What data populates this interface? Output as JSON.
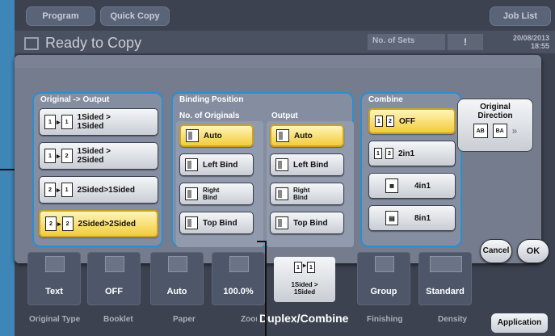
{
  "header": {
    "program_label": "Program",
    "quick_copy_label": "Quick Copy",
    "job_list_label": "Job List",
    "status": "Ready to Copy",
    "no_of_sets_label": "No. of Sets",
    "warning_icon": "!",
    "date": "20/08/2013",
    "time": "18:55"
  },
  "original_output": {
    "title": "Original -> Output",
    "options": [
      {
        "label_line1": "1Sided >",
        "label_line2": "1Sided",
        "selected": false
      },
      {
        "label_line1": "1Sided >",
        "label_line2": "2Sided",
        "selected": false
      },
      {
        "label_line1": "2Sided>1Sided",
        "label_line2": "",
        "selected": false
      },
      {
        "label_line1": "2Sided>2Sided",
        "label_line2": "",
        "selected": true
      }
    ]
  },
  "binding": {
    "title": "Binding Position",
    "originals_header": "No. of Originals",
    "output_header": "Output",
    "originals": [
      {
        "label": "Auto",
        "selected": true
      },
      {
        "label": "Left Bind",
        "selected": false
      },
      {
        "label_line1": "Right",
        "label_line2": "Bind",
        "selected": false
      },
      {
        "label": "Top Bind",
        "selected": false
      }
    ],
    "output": [
      {
        "label": "Auto",
        "selected": true
      },
      {
        "label": "Left Bind",
        "selected": false
      },
      {
        "label_line1": "Right",
        "label_line2": "Bind",
        "selected": false
      },
      {
        "label": "Top Bind",
        "selected": false
      }
    ]
  },
  "combine": {
    "title": "Combine",
    "options": [
      {
        "label": "OFF",
        "selected": true
      },
      {
        "label": "2in1",
        "selected": false
      },
      {
        "label": "4in1",
        "selected": false
      },
      {
        "label": "8in1",
        "selected": false
      }
    ]
  },
  "original_direction": {
    "line1": "Original",
    "line2": "Direction",
    "icon1": "AB",
    "icon2": "BA",
    "more": "»"
  },
  "actions": {
    "cancel": "Cancel",
    "ok": "OK"
  },
  "bottom_bar": {
    "tiles": [
      {
        "value": "Text",
        "label": "Original Type"
      },
      {
        "value": "OFF",
        "label": "Booklet"
      },
      {
        "value": "Auto",
        "label": "Paper"
      },
      {
        "value": "100.0%",
        "label": "Zoom"
      },
      {
        "value_line1": "1Sided >",
        "value_line2": "1Sided",
        "label": "Duplex/Combine"
      },
      {
        "value": "Group",
        "label": "Finishing"
      },
      {
        "value": "Standard",
        "label": "Density"
      }
    ],
    "application_label": "Application"
  },
  "colors": {
    "accent": "#2a8fd1",
    "selected": "#f2cc3c",
    "background": "#3f86b8"
  }
}
